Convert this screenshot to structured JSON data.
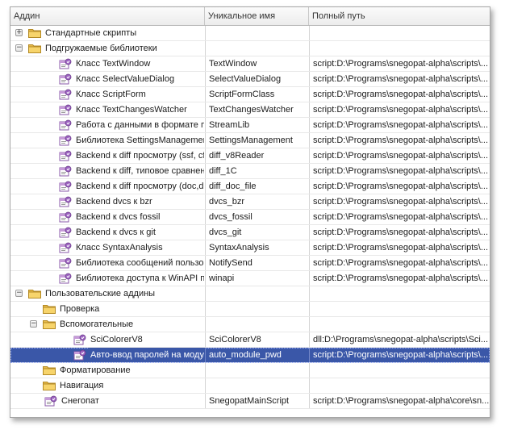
{
  "columns": {
    "addin": "Аддин",
    "unique": "Уникальное имя",
    "path": "Полный путь"
  },
  "rows": [
    {
      "type": "folder",
      "level": 0,
      "expander": "+",
      "name": "Стандартные скрипты",
      "unique": "",
      "path": ""
    },
    {
      "type": "folder",
      "level": 0,
      "expander": "−",
      "name": "Подгружаемые библиотеки",
      "unique": "",
      "path": ""
    },
    {
      "type": "addin",
      "level": 1,
      "name": "Класс TextWindow",
      "unique": "TextWindow",
      "path": "script:D:\\Programs\\snegopat-alpha\\scripts\\..."
    },
    {
      "type": "addin",
      "level": 1,
      "name": "Класс SelectValueDialog",
      "unique": "SelectValueDialog",
      "path": "script:D:\\Programs\\snegopat-alpha\\scripts\\..."
    },
    {
      "type": "addin",
      "level": 1,
      "name": "Класс ScriptForm",
      "unique": "ScriptFormClass",
      "path": "script:D:\\Programs\\snegopat-alpha\\scripts\\..."
    },
    {
      "type": "addin",
      "level": 1,
      "name": "Класс TextChangesWatcher",
      "unique": "TextChangesWatcher",
      "path": "script:D:\\Programs\\snegopat-alpha\\scripts\\..."
    },
    {
      "type": "addin",
      "level": 1,
      "name": "Работа с данными в формате п...",
      "unique": "StreamLib",
      "path": "script:D:\\Programs\\snegopat-alpha\\scripts\\..."
    },
    {
      "type": "addin",
      "level": 1,
      "name": "Библиотека SettingsManagement",
      "unique": "SettingsManagement",
      "path": "script:D:\\Programs\\snegopat-alpha\\scripts\\..."
    },
    {
      "type": "addin",
      "level": 1,
      "name": "Backend к diff просмотру (ssf, cf)",
      "unique": "diff_v8Reader",
      "path": "script:D:\\Programs\\snegopat-alpha\\scripts\\..."
    },
    {
      "type": "addin",
      "level": 1,
      "name": "Backend к diff, типовое сравнен...",
      "unique": "diff_1C",
      "path": "script:D:\\Programs\\snegopat-alpha\\scripts\\..."
    },
    {
      "type": "addin",
      "level": 1,
      "name": "Backend к diff просмотру (doc,d...",
      "unique": "diff_doc_file",
      "path": "script:D:\\Programs\\snegopat-alpha\\scripts\\..."
    },
    {
      "type": "addin",
      "level": 1,
      "name": "Backend dvcs к bzr",
      "unique": "dvcs_bzr",
      "path": "script:D:\\Programs\\snegopat-alpha\\scripts\\..."
    },
    {
      "type": "addin",
      "level": 1,
      "name": "Backend к dvcs fossil",
      "unique": "dvcs_fossil",
      "path": "script:D:\\Programs\\snegopat-alpha\\scripts\\..."
    },
    {
      "type": "addin",
      "level": 1,
      "name": "Backend к dvcs к git",
      "unique": "dvcs_git",
      "path": "script:D:\\Programs\\snegopat-alpha\\scripts\\..."
    },
    {
      "type": "addin",
      "level": 1,
      "name": "Класс SyntaxAnalysis",
      "unique": "SyntaxAnalysis",
      "path": "script:D:\\Programs\\snegopat-alpha\\scripts\\..."
    },
    {
      "type": "addin",
      "level": 1,
      "name": "Библиотека сообщений пользо...",
      "unique": "NotifySend",
      "path": "script:D:\\Programs\\snegopat-alpha\\scripts\\..."
    },
    {
      "type": "addin",
      "level": 1,
      "name": "Библиотека доступа к WinAPI п...",
      "unique": "winapi",
      "path": "script:D:\\Programs\\snegopat-alpha\\scripts\\..."
    },
    {
      "type": "folder",
      "level": 0,
      "expander": "−",
      "name": "Пользовательские аддины",
      "unique": "",
      "path": ""
    },
    {
      "type": "folder",
      "level": 1,
      "expander": "",
      "name": "Проверка",
      "unique": "",
      "path": ""
    },
    {
      "type": "folder",
      "level": 1,
      "expander": "−",
      "name": "Вспомогательные",
      "unique": "",
      "path": ""
    },
    {
      "type": "addin",
      "level": 2,
      "name": "SciColorerV8",
      "unique": "SciColorerV8",
      "path": "dll:D:\\Programs\\snegopat-alpha\\scripts\\Sci..."
    },
    {
      "type": "addin",
      "level": 2,
      "name": "Авто-ввод паролей на модуль",
      "unique": "auto_module_pwd",
      "path": "script:D:\\Programs\\snegopat-alpha\\scripts\\...",
      "selected": true
    },
    {
      "type": "folder",
      "level": 1,
      "expander": "",
      "name": "Форматирование",
      "unique": "",
      "path": ""
    },
    {
      "type": "folder",
      "level": 1,
      "expander": "",
      "name": "Навигация",
      "unique": "",
      "path": ""
    },
    {
      "type": "addin",
      "level": 0,
      "name": "Снегопат",
      "unique": "SnegopatMainScript",
      "path": "script:D:\\Programs\\snegopat-alpha\\core\\sn..."
    }
  ]
}
